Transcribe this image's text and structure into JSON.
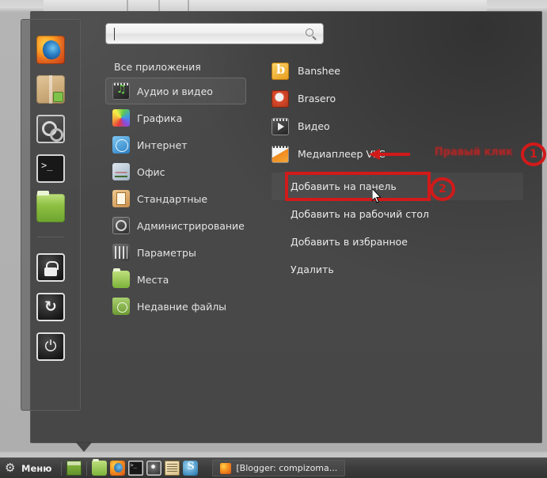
{
  "desktop": {
    "background_color": "#b4b4b4"
  },
  "menu": {
    "panel_color": "#3f3f3f",
    "search": {
      "value": "",
      "placeholder": "",
      "icon": "search-icon"
    },
    "favorites_dock": [
      {
        "name": "firefox",
        "label": "Firefox"
      },
      {
        "name": "package-manager",
        "label": "Software Manager"
      },
      {
        "name": "control-center",
        "label": "Control Center"
      },
      {
        "name": "terminal",
        "label": "Terminal"
      },
      {
        "name": "files",
        "label": "Files"
      },
      {
        "name": "lock-screen",
        "label": "Lock Screen"
      },
      {
        "name": "log-out",
        "label": "Log Out"
      },
      {
        "name": "shutdown",
        "label": "Shutdown"
      }
    ],
    "all_applications_label": "Все приложения",
    "categories": [
      {
        "label": "Аудио и видео",
        "icon": "audio-video-icon",
        "selected": true
      },
      {
        "label": "Графика",
        "icon": "graphics-icon",
        "selected": false
      },
      {
        "label": "Интернет",
        "icon": "internet-icon",
        "selected": false
      },
      {
        "label": "Офис",
        "icon": "office-icon",
        "selected": false
      },
      {
        "label": "Стандартные",
        "icon": "accessories-icon",
        "selected": false
      },
      {
        "label": "Администрирование",
        "icon": "administration-icon",
        "selected": false
      },
      {
        "label": "Параметры",
        "icon": "preferences-icon",
        "selected": false
      },
      {
        "label": "Места",
        "icon": "places-icon",
        "selected": false
      },
      {
        "label": "Недавние файлы",
        "icon": "recent-files-icon",
        "selected": false
      }
    ],
    "applications": [
      {
        "label": "Banshee",
        "icon": "banshee-icon"
      },
      {
        "label": "Brasero",
        "icon": "brasero-icon"
      },
      {
        "label": "Видео",
        "icon": "video-icon"
      },
      {
        "label": "Медиаплеер VLC",
        "icon": "vlc-icon"
      }
    ],
    "context_menu": [
      {
        "label": "Добавить на панель",
        "highlighted": true
      },
      {
        "label": "Добавить на рабочий стол",
        "highlighted": false
      },
      {
        "label": "Добавить в избранное",
        "highlighted": false
      },
      {
        "label": "Удалить",
        "highlighted": false
      }
    ]
  },
  "annotations": {
    "color": "#d11a1a",
    "text": "Правый клик",
    "badge_1": "1",
    "badge_2": "2",
    "arrow": "arrow-left-icon"
  },
  "taskbar": {
    "menu_label": "Меню",
    "menu_icon": "gear-icon",
    "launchers": [
      {
        "name": "show-desktop",
        "label": "Show Desktop"
      },
      {
        "name": "file-manager",
        "label": "Files"
      },
      {
        "name": "firefox",
        "label": "Firefox"
      },
      {
        "name": "terminal",
        "label": "Terminal"
      },
      {
        "name": "disc-app",
        "label": "Disc"
      },
      {
        "name": "notes",
        "label": "Notes"
      },
      {
        "name": "blue-app",
        "label": "App"
      }
    ],
    "windows": [
      {
        "title": "[Blogger: compizoma...",
        "icon": "firefox-icon",
        "active": false
      }
    ]
  }
}
